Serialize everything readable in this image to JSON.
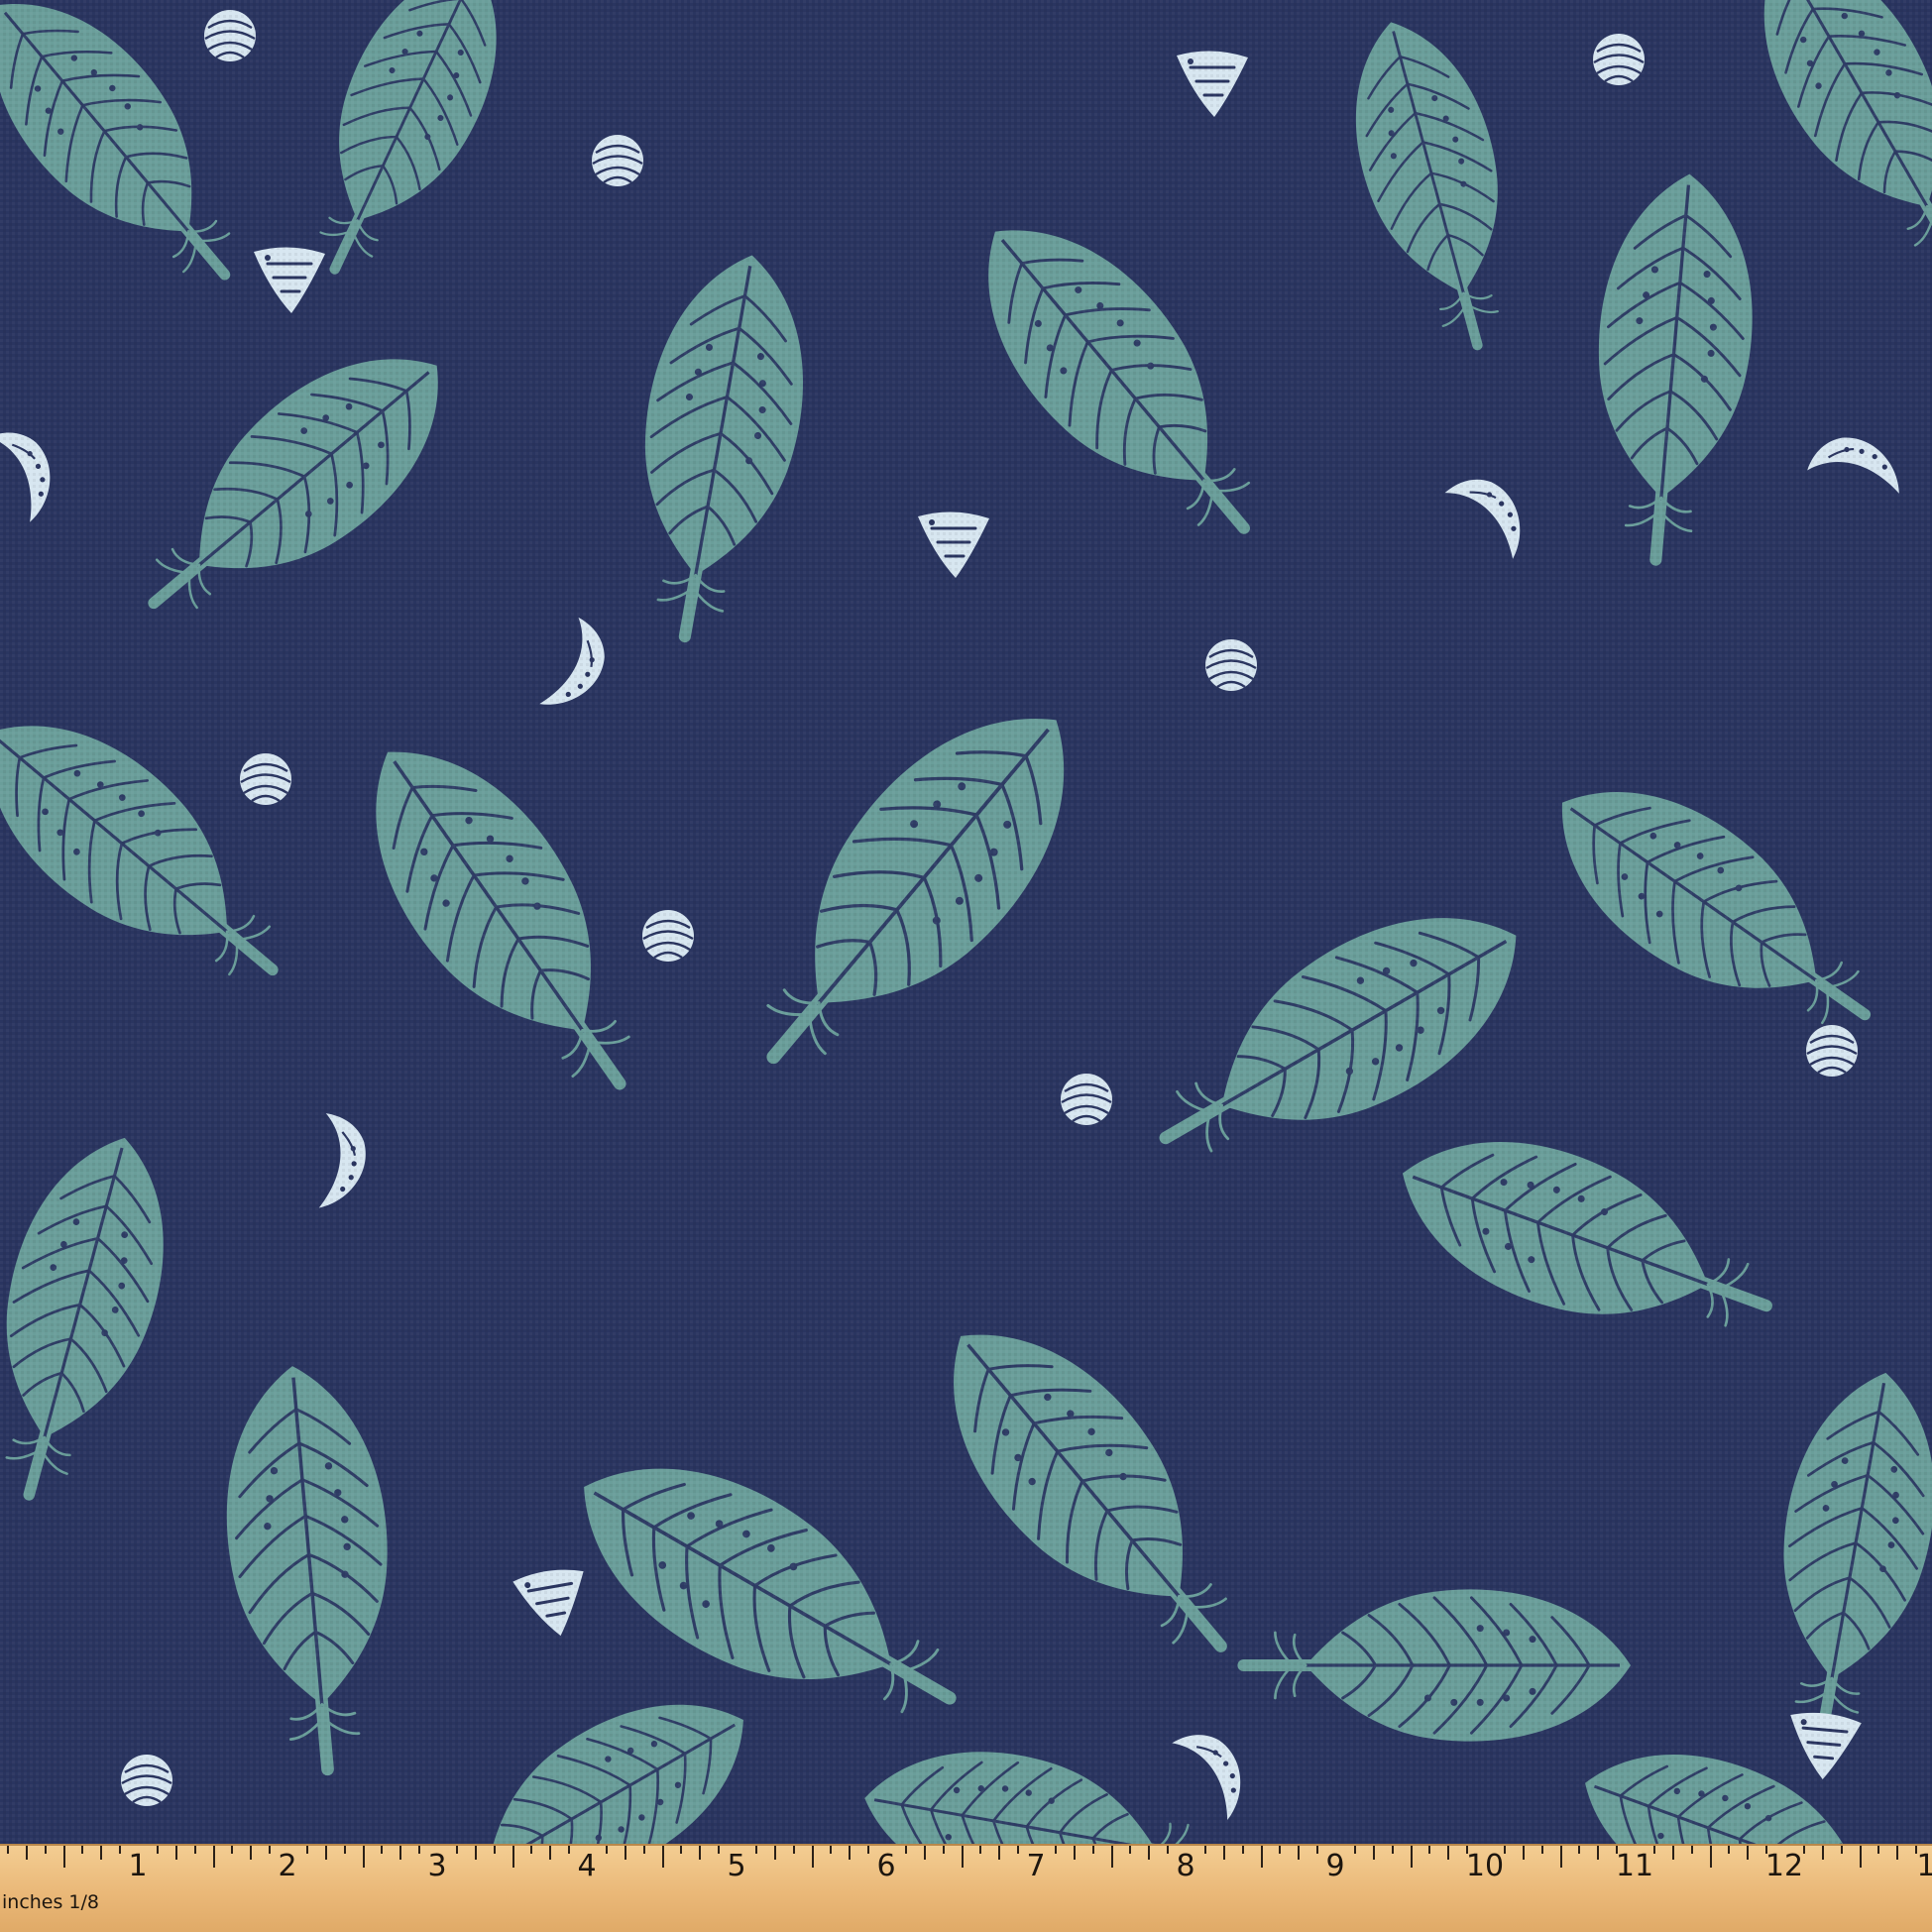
{
  "image": {
    "subject": "feather-pattern-fabric",
    "colors": {
      "background": "#2a3560",
      "feather": "#6a9e9a",
      "feather_vein": "#2f3d66",
      "accent_shape": "#d7e6f0",
      "ruler": "#eab878",
      "ruler_ink": "#1d160f"
    }
  },
  "ruler": {
    "unit_label": "inches  1/8",
    "numbers": [
      "1",
      "2",
      "3",
      "4",
      "5",
      "6",
      "7",
      "8",
      "9",
      "10",
      "11",
      "12",
      "1"
    ]
  }
}
